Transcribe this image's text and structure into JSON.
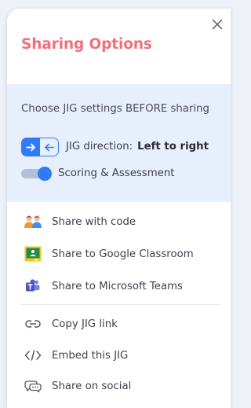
{
  "colors": {
    "title": "#f06f7d",
    "accent": "#2f7cf6",
    "settings_bg": "#e6effb"
  },
  "dialog": {
    "title": "Sharing Options",
    "close_icon": "close-icon"
  },
  "settings": {
    "heading": "Choose JIG settings BEFORE sharing",
    "direction": {
      "label": "JIG direction:",
      "value": "Left to right",
      "options": [
        "right-arrow",
        "left-arrow"
      ],
      "selected": "right-arrow"
    },
    "scoring": {
      "label": "Scoring & Assessment",
      "enabled": true
    }
  },
  "share_items": [
    {
      "label": "Share with code",
      "icon": "people-icon"
    },
    {
      "label": "Share to Google Classroom",
      "icon": "google-classroom-icon"
    },
    {
      "label": "Share to Microsoft Teams",
      "icon": "microsoft-teams-icon"
    }
  ],
  "link_items": [
    {
      "label": "Copy JIG link",
      "icon": "link-icon"
    },
    {
      "label": "Embed this JIG",
      "icon": "code-icon"
    },
    {
      "label": "Share on social",
      "icon": "chat-bubbles-icon"
    }
  ]
}
